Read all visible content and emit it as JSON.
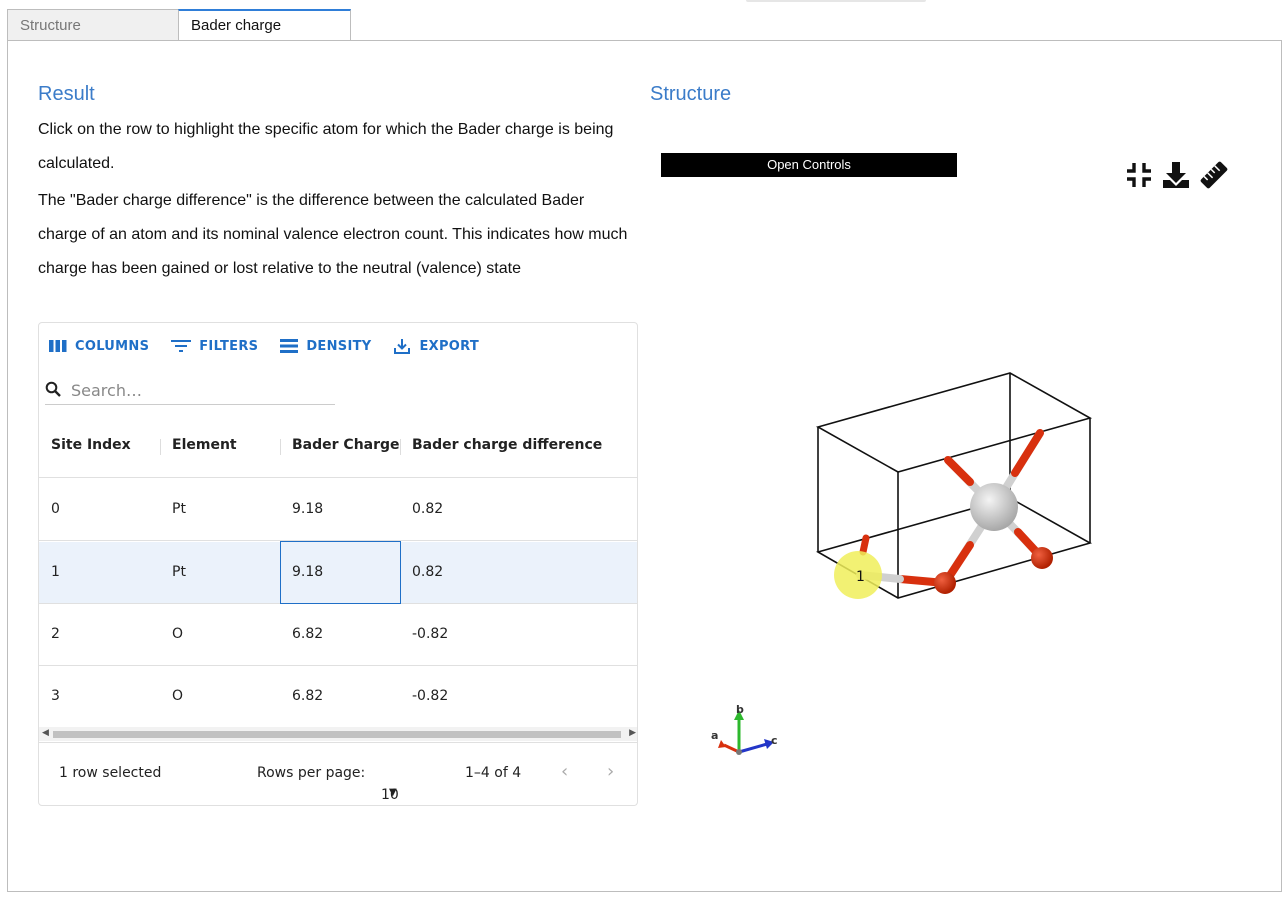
{
  "tabs": [
    {
      "label": "Structure",
      "active": false
    },
    {
      "label": "Bader charge",
      "active": true
    }
  ],
  "result": {
    "title": "Result",
    "paragraph1": "Click on the row to highlight the specific atom for which the Bader charge is being calculated.",
    "paragraph2": "The \"Bader charge difference\" is the difference between the calculated Bader charge of an atom and its nominal valence electron count. This indicates how much charge has been gained or lost relative to the neutral (valence) state"
  },
  "toolbar": {
    "columns": "COLUMNS",
    "filters": "FILTERS",
    "density": "DENSITY",
    "export": "EXPORT"
  },
  "search": {
    "placeholder": "Search…"
  },
  "table": {
    "headers": [
      "Site Index",
      "Element",
      "Bader Charge",
      "Bader charge difference"
    ],
    "rows": [
      {
        "site_index": "0",
        "element": "Pt",
        "bader_charge": "9.18",
        "difference": "0.82",
        "selected": false
      },
      {
        "site_index": "1",
        "element": "Pt",
        "bader_charge": "9.18",
        "difference": "0.82",
        "selected": true
      },
      {
        "site_index": "2",
        "element": "O",
        "bader_charge": "6.82",
        "difference": "-0.82",
        "selected": false
      },
      {
        "site_index": "3",
        "element": "O",
        "bader_charge": "6.82",
        "difference": "-0.82",
        "selected": false
      }
    ]
  },
  "footer": {
    "selected_text": "1 row selected",
    "rows_per_page_label": "Rows per page:",
    "rows_per_page_value": "10",
    "range_text": "1–4 of 4"
  },
  "structure": {
    "title": "Structure",
    "open_controls": "Open Controls",
    "highlight_label": "1",
    "axes": {
      "a": "a",
      "b": "b",
      "c": "c"
    },
    "colors": {
      "oxygen": "#d8300e",
      "platinum": "#d0d0d0",
      "highlight": "#f0ee5a",
      "accent": "#3b7cc9"
    },
    "tool_icons": [
      "compress-icon",
      "download-icon",
      "ruler-icon"
    ]
  }
}
